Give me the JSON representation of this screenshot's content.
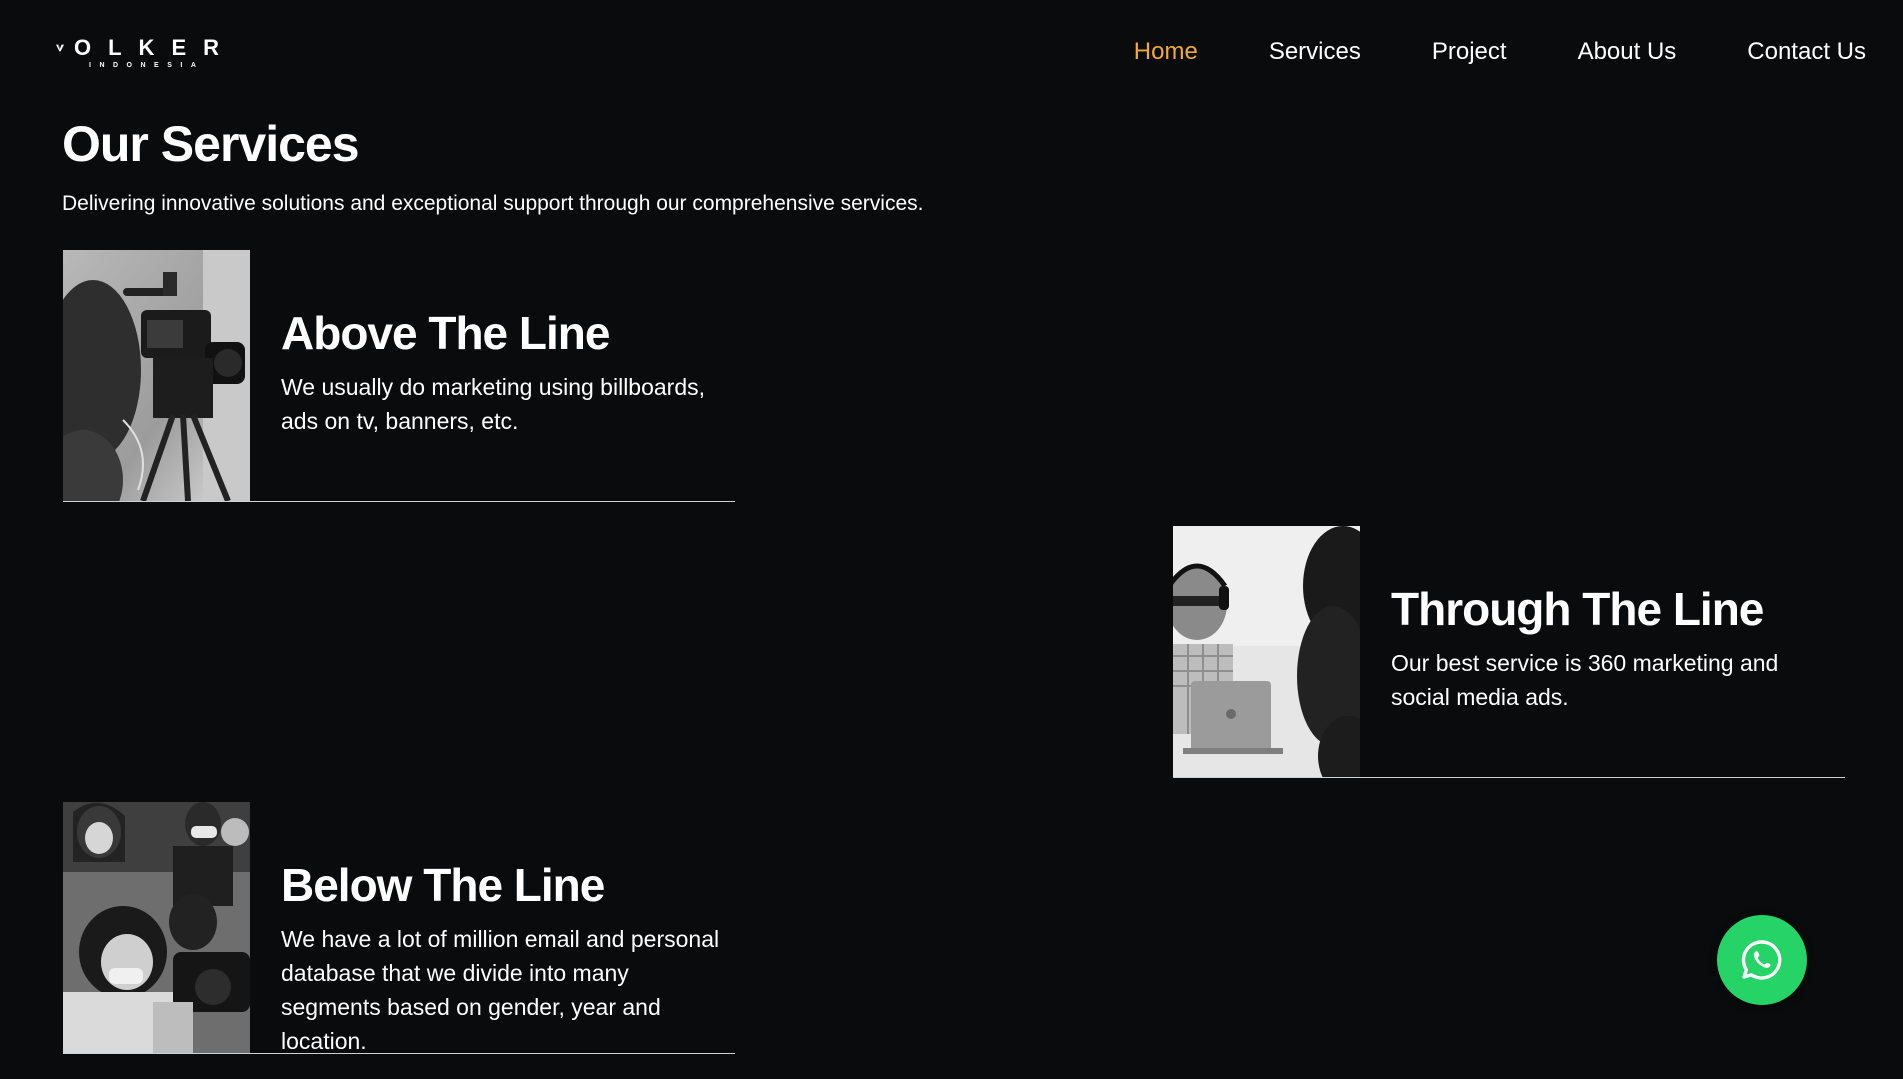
{
  "brand": {
    "logo_text": "VOLKER",
    "logo_rest": "OLKER",
    "logo_subtitle": "INDONESIA"
  },
  "nav": {
    "items": [
      {
        "label": "Home",
        "active": true
      },
      {
        "label": "Services",
        "active": false
      },
      {
        "label": "Project",
        "active": false
      },
      {
        "label": "About Us",
        "active": false
      },
      {
        "label": "Contact Us",
        "active": false
      }
    ],
    "active_color": "#f2a83b"
  },
  "intro": {
    "title": "Our Services",
    "subtitle": "Delivering innovative solutions and exceptional support through our comprehensive services."
  },
  "services": [
    {
      "title": "Above The Line",
      "description": "We usually do marketing using billboards, ads on tv, banners, etc.",
      "image": "camera-operator-photo"
    },
    {
      "title": "Through The Line",
      "description": "Our best service is 360 marketing and social media ads.",
      "image": "man-with-headphones-laptop-photo"
    },
    {
      "title": "Below The Line",
      "description": "We have a lot of million email and personal database that we divide into many segments based on gender, year and location.",
      "image": "film-crew-photo"
    }
  ],
  "whatsapp": {
    "icon": "whatsapp-icon",
    "color": "#25d366"
  },
  "colors": {
    "background": "#0a0b0c",
    "text": "#ffffff",
    "divider": "#cfd2d4"
  }
}
